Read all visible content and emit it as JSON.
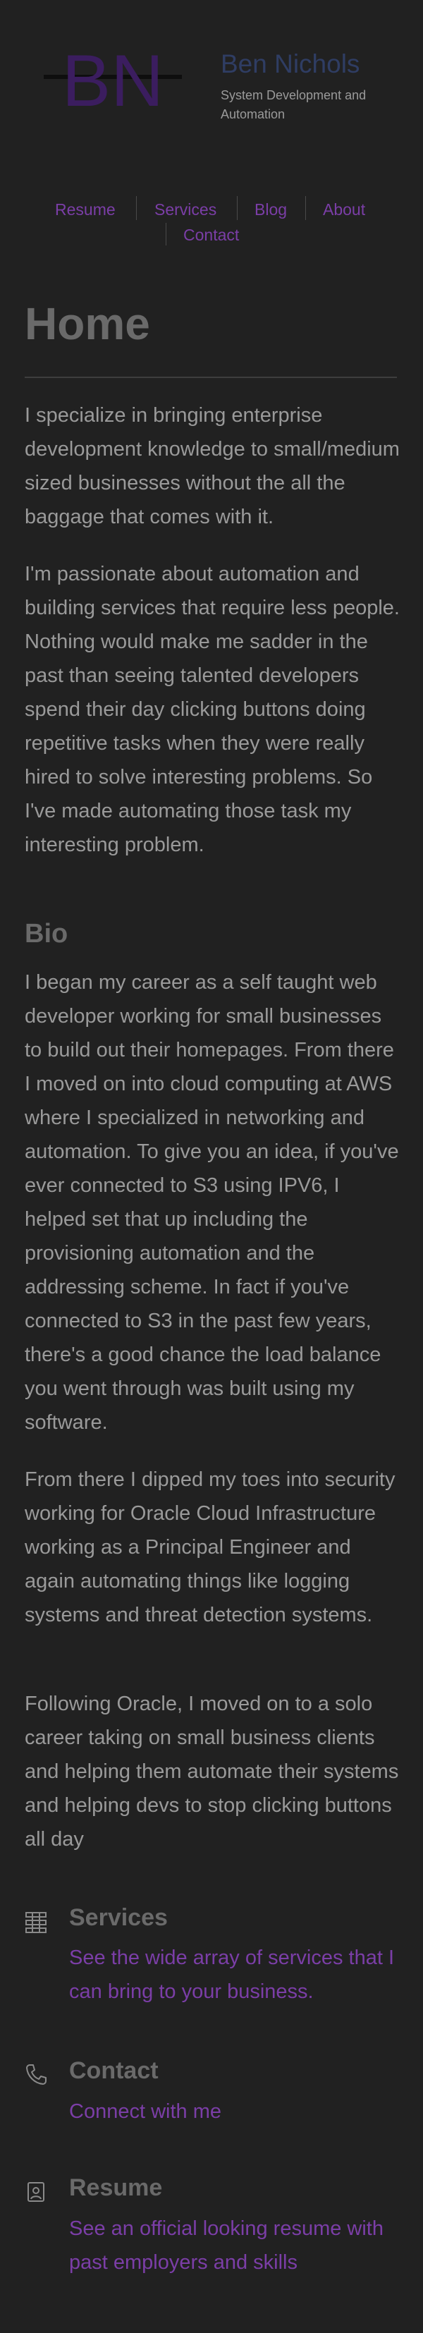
{
  "brand": {
    "logo_text": "BN",
    "name": "Ben Nichols",
    "tagline": "System Development and Automation"
  },
  "nav": {
    "items": [
      "Resume",
      "Services",
      "Blog",
      "About",
      "Contact"
    ]
  },
  "page": {
    "title": "Home",
    "intro": [
      "I specialize in bringing enterprise development knowledge to small/medium sized businesses without the all the baggage that comes with it.",
      "I'm passionate about automation and building services that require less people. Nothing would make me sadder in the past than seeing talented developers spend their day clicking buttons doing repetitive tasks when they were really hired to solve interesting problems. So I've made automating those task my interesting problem."
    ],
    "bio_heading": "Bio",
    "bio": [
      "I began my career as a self taught web developer working for small businesses to build out their homepages. From there I moved on into cloud computing at AWS where I specialized in networking and automation. To give you an idea, if you've ever connected to S3 using IPV6, I helped set that up including the provisioning automation and the addressing scheme. In fact if you've connected to S3 in the past few years, there's a good chance the load balance you went through was built using my software.",
      "From there I dipped my toes into security working for Oracle Cloud Infrastructure working as a Principal Engineer and again automating things like logging systems and threat detection systems.",
      "Following Oracle, I moved on to a solo career taking on small business clients and helping them automate their systems and helping devs to stop clicking buttons all day"
    ]
  },
  "cards": [
    {
      "icon": "services-grid-icon",
      "title": "Services",
      "link": "See the wide array of services that I can bring to your business."
    },
    {
      "icon": "phone-icon",
      "title": "Contact",
      "link": "Connect with me"
    },
    {
      "icon": "resume-badge-icon",
      "title": "Resume",
      "link": "See an official looking resume with past employers and skills"
    }
  ],
  "colors": {
    "background": "#212121",
    "accent": "#7b3ea7",
    "brand_name": "#2f3d63",
    "text": "#9a9a9a"
  }
}
